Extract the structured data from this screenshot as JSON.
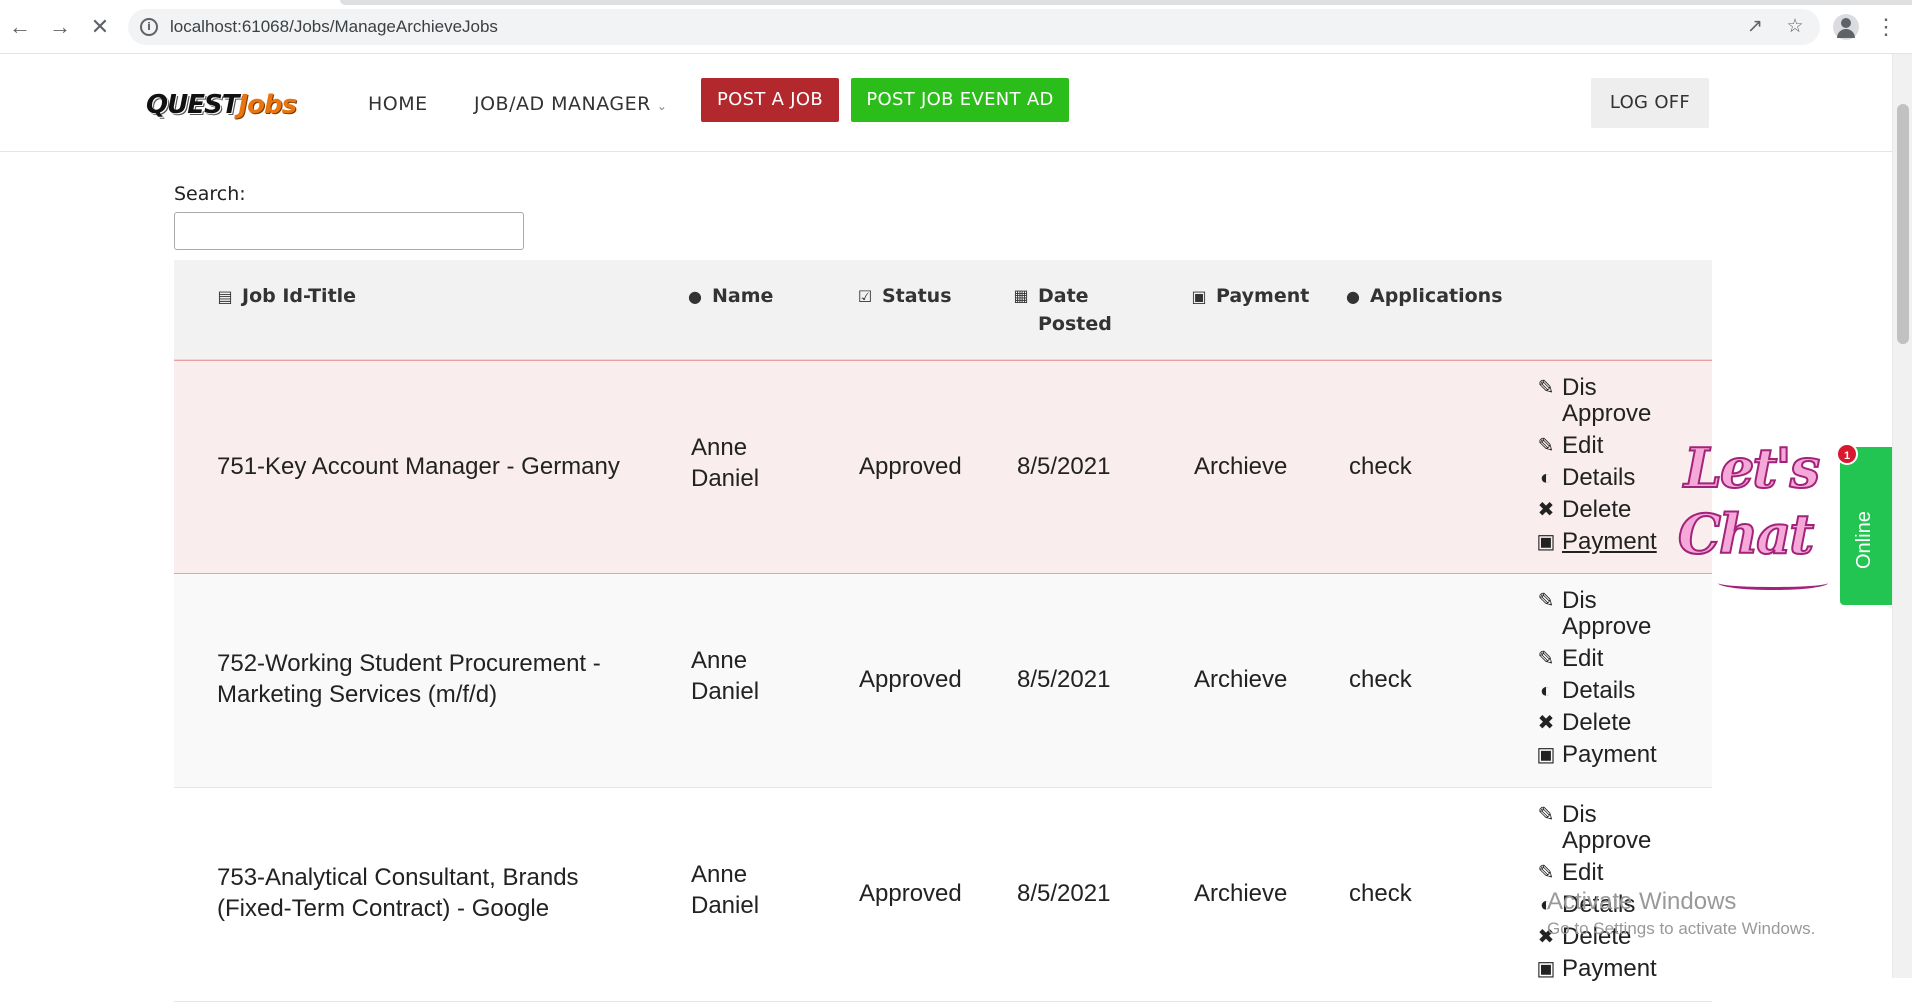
{
  "browser": {
    "url": "localhost:61068/Jobs/ManageArchieveJobs",
    "back_icon": "arrow-left-icon",
    "forward_icon": "arrow-right-icon",
    "reload_icon": "close-icon"
  },
  "site": {
    "logo_quest": "QUEST",
    "logo_jobs": "Jobs",
    "nav": {
      "home": "HOME",
      "manager": "JOB/AD MANAGER"
    },
    "buttons": {
      "post_job": "POST A JOB",
      "post_event": "POST JOB EVENT AD",
      "log_off": "LOG OFF"
    },
    "colors": {
      "post_job": "#b3282d",
      "post_event": "#2bbd1a",
      "row_highlight": "#f9eded"
    }
  },
  "search": {
    "label": "Search:",
    "value": ""
  },
  "table": {
    "headers": {
      "job": "Job Id-Title",
      "name": "Name",
      "status": "Status",
      "date": "Date Posted",
      "payment": "Payment",
      "applications": "Applications"
    },
    "action_labels": {
      "disapprove_1": "Dis",
      "disapprove_2": "Approve",
      "edit": "Edit",
      "details": "Details",
      "delete": "Delete",
      "payment": "Payment"
    },
    "rows": [
      {
        "title_1": "751-Key Account Manager - Germany",
        "title_2": "",
        "name_1": "Anne",
        "name_2": "Daniel",
        "status": "Approved",
        "date": "8/5/2021",
        "payment": "Archieve",
        "applications": "check"
      },
      {
        "title_1": "752-Working Student Procurement -",
        "title_2": "Marketing Services (m/f/d)",
        "name_1": "Anne",
        "name_2": "Daniel",
        "status": "Approved",
        "date": "8/5/2021",
        "payment": "Archieve",
        "applications": "check"
      },
      {
        "title_1": "753-Analytical Consultant, Brands",
        "title_2": "(Fixed-Term Contract) - Google",
        "name_1": "Anne",
        "name_2": "Daniel",
        "status": "Approved",
        "date": "8/5/2021",
        "payment": "Archieve",
        "applications": "check"
      }
    ]
  },
  "chat": {
    "line1": "Let's",
    "line2": "Chat",
    "status": "Online",
    "count": "1"
  },
  "watermark": {
    "title": "Activate Windows",
    "subtitle": "Go to Settings to activate Windows."
  }
}
